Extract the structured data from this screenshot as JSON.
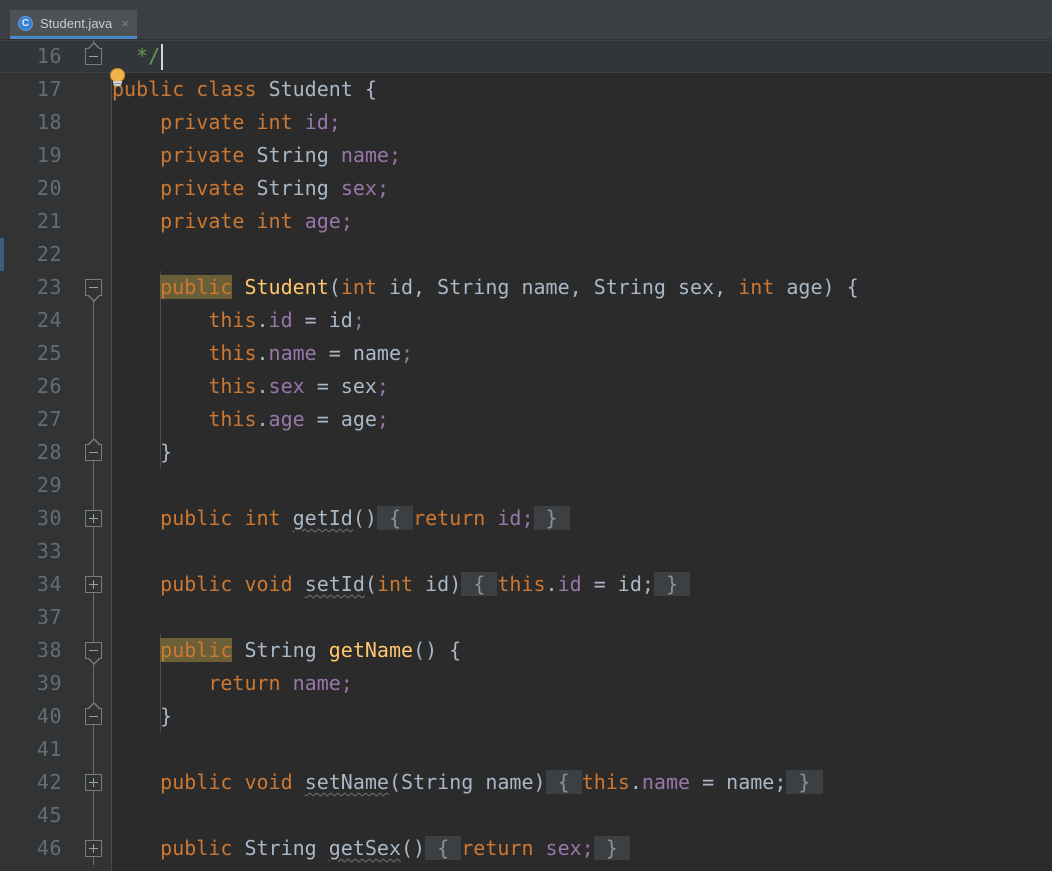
{
  "window": {
    "app": "IntelliJ IDEA Editor",
    "background_color": "#2b2b2b"
  },
  "tabbar": {
    "tabs": [
      {
        "label": "Student.java",
        "icon": "java-class-icon",
        "icon_letter": "C",
        "close_label": "×",
        "active": true,
        "underline_color": "#4a88c7"
      }
    ]
  },
  "editor": {
    "language": "Java",
    "font_size_px": 20,
    "line_height_px": 33,
    "gutter_background": "#313335",
    "current_line_number": 16,
    "current_line_background": "#323639",
    "caret_color": "#d6d6d6",
    "colors": {
      "keyword": "#cc7832",
      "field": "#9876aa",
      "method_declaration": "#ffc66d",
      "comment": "#629755",
      "default_text": "#a9b7c6",
      "line_number": "#656d72",
      "usage_highlight_bg": "#6b5f37",
      "folded_region_bg": "#3d4042",
      "vcs_changed_marker": "#3b5e80"
    },
    "intention_bulb": {
      "icon": "lightbulb-icon",
      "on_line": 17
    },
    "lines": [
      {
        "number": "16",
        "text": "*/",
        "current": true,
        "fold": "region-end",
        "tokens": [
          {
            "t": "  ",
            "c": "pun"
          },
          {
            "t": "*/",
            "c": "cmt"
          }
        ]
      },
      {
        "number": "17",
        "text": "public class Student {",
        "tokens": [
          {
            "t": "public",
            "c": "kw"
          },
          {
            "t": " ",
            "c": "pun"
          },
          {
            "t": "class",
            "c": "kw"
          },
          {
            "t": " ",
            "c": "pun"
          },
          {
            "t": "Student",
            "c": "cls"
          },
          {
            "t": " {",
            "c": "pun"
          }
        ]
      },
      {
        "number": "18",
        "text": "    private int id;",
        "tokens": [
          {
            "t": "    ",
            "c": "pun"
          },
          {
            "t": "private",
            "c": "kw"
          },
          {
            "t": " ",
            "c": "pun"
          },
          {
            "t": "int",
            "c": "kw"
          },
          {
            "t": " ",
            "c": "pun"
          },
          {
            "t": "id",
            "c": "fld"
          },
          {
            "t": ";",
            "c": "fld"
          }
        ]
      },
      {
        "number": "19",
        "text": "    private String name;",
        "tokens": [
          {
            "t": "    ",
            "c": "pun"
          },
          {
            "t": "private",
            "c": "kw"
          },
          {
            "t": " ",
            "c": "pun"
          },
          {
            "t": "String",
            "c": "cls"
          },
          {
            "t": " ",
            "c": "pun"
          },
          {
            "t": "name",
            "c": "fld"
          },
          {
            "t": ";",
            "c": "fld"
          }
        ]
      },
      {
        "number": "20",
        "text": "    private String sex;",
        "tokens": [
          {
            "t": "    ",
            "c": "pun"
          },
          {
            "t": "private",
            "c": "kw"
          },
          {
            "t": " ",
            "c": "pun"
          },
          {
            "t": "String",
            "c": "cls"
          },
          {
            "t": " ",
            "c": "pun"
          },
          {
            "t": "sex",
            "c": "fld"
          },
          {
            "t": ";",
            "c": "fld"
          }
        ]
      },
      {
        "number": "21",
        "text": "    private int age;",
        "tokens": [
          {
            "t": "    ",
            "c": "pun"
          },
          {
            "t": "private",
            "c": "kw"
          },
          {
            "t": " ",
            "c": "pun"
          },
          {
            "t": "int",
            "c": "kw"
          },
          {
            "t": " ",
            "c": "pun"
          },
          {
            "t": "age",
            "c": "fld"
          },
          {
            "t": ";",
            "c": "fld"
          }
        ]
      },
      {
        "number": "22",
        "text": "",
        "vcs_changed": true,
        "tokens": []
      },
      {
        "number": "23",
        "text": "    public Student(int id, String name, String sex, int age) {",
        "fold": "region-start",
        "tokens": [
          {
            "t": "    ",
            "c": "pun"
          },
          {
            "t": "public",
            "c": "hl-usage"
          },
          {
            "t": " ",
            "c": "pun"
          },
          {
            "t": "Student",
            "c": "decl"
          },
          {
            "t": "(",
            "c": "pun"
          },
          {
            "t": "int",
            "c": "kw"
          },
          {
            "t": " id, ",
            "c": "pun"
          },
          {
            "t": "String",
            "c": "cls"
          },
          {
            "t": " name, ",
            "c": "pun"
          },
          {
            "t": "String",
            "c": "cls"
          },
          {
            "t": " sex, ",
            "c": "pun"
          },
          {
            "t": "int",
            "c": "kw"
          },
          {
            "t": " age) {",
            "c": "pun"
          }
        ]
      },
      {
        "number": "24",
        "text": "        this.id = id;",
        "tokens": [
          {
            "t": "        ",
            "c": "pun"
          },
          {
            "t": "this",
            "c": "kw"
          },
          {
            "t": ".",
            "c": "pun"
          },
          {
            "t": "id",
            "c": "fld"
          },
          {
            "t": " = id",
            "c": "pun"
          },
          {
            "t": ";",
            "c": "fld"
          }
        ]
      },
      {
        "number": "25",
        "text": "        this.name = name;",
        "tokens": [
          {
            "t": "        ",
            "c": "pun"
          },
          {
            "t": "this",
            "c": "kw"
          },
          {
            "t": ".",
            "c": "pun"
          },
          {
            "t": "name",
            "c": "fld"
          },
          {
            "t": " = name",
            "c": "pun"
          },
          {
            "t": ";",
            "c": "fld"
          }
        ]
      },
      {
        "number": "26",
        "text": "        this.sex = sex;",
        "tokens": [
          {
            "t": "        ",
            "c": "pun"
          },
          {
            "t": "this",
            "c": "kw"
          },
          {
            "t": ".",
            "c": "pun"
          },
          {
            "t": "sex",
            "c": "fld"
          },
          {
            "t": " = sex",
            "c": "pun"
          },
          {
            "t": ";",
            "c": "fld"
          }
        ]
      },
      {
        "number": "27",
        "text": "        this.age = age;",
        "tokens": [
          {
            "t": "        ",
            "c": "pun"
          },
          {
            "t": "this",
            "c": "kw"
          },
          {
            "t": ".",
            "c": "pun"
          },
          {
            "t": "age",
            "c": "fld"
          },
          {
            "t": " = age",
            "c": "pun"
          },
          {
            "t": ";",
            "c": "fld"
          }
        ]
      },
      {
        "number": "28",
        "text": "    }",
        "fold": "region-end",
        "tokens": [
          {
            "t": "    }",
            "c": "pun"
          }
        ]
      },
      {
        "number": "29",
        "text": "",
        "tokens": []
      },
      {
        "number": "30",
        "text": "    public int getId() { return id; }",
        "fold": "collapsed",
        "tokens": [
          {
            "t": "    ",
            "c": "pun"
          },
          {
            "t": "public",
            "c": "kw"
          },
          {
            "t": " ",
            "c": "pun"
          },
          {
            "t": "int",
            "c": "kw"
          },
          {
            "t": " ",
            "c": "pun"
          },
          {
            "t": "getId",
            "c": "pun wavy"
          },
          {
            "t": "()",
            "c": "pun"
          },
          {
            "t": " { ",
            "c": "folded"
          },
          {
            "t": "return",
            "c": "kw"
          },
          {
            "t": " ",
            "c": "pun"
          },
          {
            "t": "id;",
            "c": "fld"
          },
          {
            "t": " } ",
            "c": "folded"
          }
        ]
      },
      {
        "number": "33",
        "text": "",
        "tokens": []
      },
      {
        "number": "34",
        "text": "    public void setId(int id) { this.id = id; }",
        "fold": "collapsed",
        "tokens": [
          {
            "t": "    ",
            "c": "pun"
          },
          {
            "t": "public",
            "c": "kw"
          },
          {
            "t": " ",
            "c": "pun"
          },
          {
            "t": "void",
            "c": "kw"
          },
          {
            "t": " ",
            "c": "pun"
          },
          {
            "t": "setId",
            "c": "pun wavy"
          },
          {
            "t": "(",
            "c": "pun"
          },
          {
            "t": "int",
            "c": "kw"
          },
          {
            "t": " id)",
            "c": "pun"
          },
          {
            "t": " { ",
            "c": "folded"
          },
          {
            "t": "this",
            "c": "kw"
          },
          {
            "t": ".",
            "c": "pun"
          },
          {
            "t": "id",
            "c": "fld"
          },
          {
            "t": " = id;",
            "c": "pun"
          },
          {
            "t": " } ",
            "c": "folded"
          }
        ]
      },
      {
        "number": "37",
        "text": "",
        "tokens": []
      },
      {
        "number": "38",
        "text": "    public String getName() {",
        "fold": "region-start",
        "tokens": [
          {
            "t": "    ",
            "c": "pun"
          },
          {
            "t": "public",
            "c": "hl-usage"
          },
          {
            "t": " ",
            "c": "pun"
          },
          {
            "t": "String",
            "c": "cls"
          },
          {
            "t": " ",
            "c": "pun"
          },
          {
            "t": "getName",
            "c": "decl"
          },
          {
            "t": "() {",
            "c": "pun"
          }
        ]
      },
      {
        "number": "39",
        "text": "        return name;",
        "tokens": [
          {
            "t": "        ",
            "c": "pun"
          },
          {
            "t": "return",
            "c": "kw"
          },
          {
            "t": " ",
            "c": "pun"
          },
          {
            "t": "name",
            "c": "fld"
          },
          {
            "t": ";",
            "c": "fld"
          }
        ]
      },
      {
        "number": "40",
        "text": "    }",
        "fold": "region-end",
        "tokens": [
          {
            "t": "    }",
            "c": "pun"
          }
        ]
      },
      {
        "number": "41",
        "text": "",
        "tokens": []
      },
      {
        "number": "42",
        "text": "    public void setName(String name) { this.name = name; }",
        "fold": "collapsed",
        "tokens": [
          {
            "t": "    ",
            "c": "pun"
          },
          {
            "t": "public",
            "c": "kw"
          },
          {
            "t": " ",
            "c": "pun"
          },
          {
            "t": "void",
            "c": "kw"
          },
          {
            "t": " ",
            "c": "pun"
          },
          {
            "t": "setName",
            "c": "pun wavy"
          },
          {
            "t": "(",
            "c": "pun"
          },
          {
            "t": "String",
            "c": "cls"
          },
          {
            "t": " name)",
            "c": "pun"
          },
          {
            "t": " { ",
            "c": "folded"
          },
          {
            "t": "this",
            "c": "kw"
          },
          {
            "t": ".",
            "c": "pun"
          },
          {
            "t": "name",
            "c": "fld"
          },
          {
            "t": " = name;",
            "c": "pun"
          },
          {
            "t": " } ",
            "c": "folded"
          }
        ]
      },
      {
        "number": "45",
        "text": "",
        "tokens": []
      },
      {
        "number": "46",
        "text": "    public String getSex() { return sex; }",
        "fold": "collapsed",
        "tokens": [
          {
            "t": "    ",
            "c": "pun"
          },
          {
            "t": "public",
            "c": "kw"
          },
          {
            "t": " ",
            "c": "pun"
          },
          {
            "t": "String",
            "c": "cls"
          },
          {
            "t": " ",
            "c": "pun"
          },
          {
            "t": "getSex",
            "c": "pun wavy"
          },
          {
            "t": "()",
            "c": "pun"
          },
          {
            "t": " { ",
            "c": "folded"
          },
          {
            "t": "return",
            "c": "kw"
          },
          {
            "t": " ",
            "c": "pun"
          },
          {
            "t": "sex;",
            "c": "fld"
          },
          {
            "t": " } ",
            "c": "folded"
          }
        ]
      }
    ]
  }
}
